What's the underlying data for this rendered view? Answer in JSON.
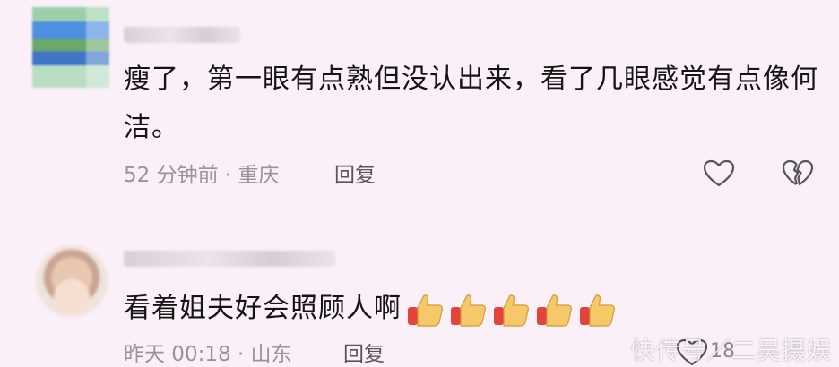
{
  "comments": [
    {
      "text": "瘦了，第一眼有点熟但没认出来，看了几眼感觉有点像何洁。",
      "time_location": "52 分钟前 · 重庆",
      "reply_label": "回复",
      "icons": [
        "heart-outline-icon",
        "broken-heart-icon"
      ]
    },
    {
      "text": "看着姐夫好会照顾人啊",
      "emoji_count": 5,
      "emoji": "thumbs-up-icon",
      "time_location": "昨天 00:18 · 山东",
      "reply_label": "回复",
      "like_count": "18"
    }
  ],
  "watermark": "快传号／二吴摄娱",
  "colors": {
    "background": "#fbeff8",
    "text": "#141414",
    "meta": "#9a9398"
  }
}
